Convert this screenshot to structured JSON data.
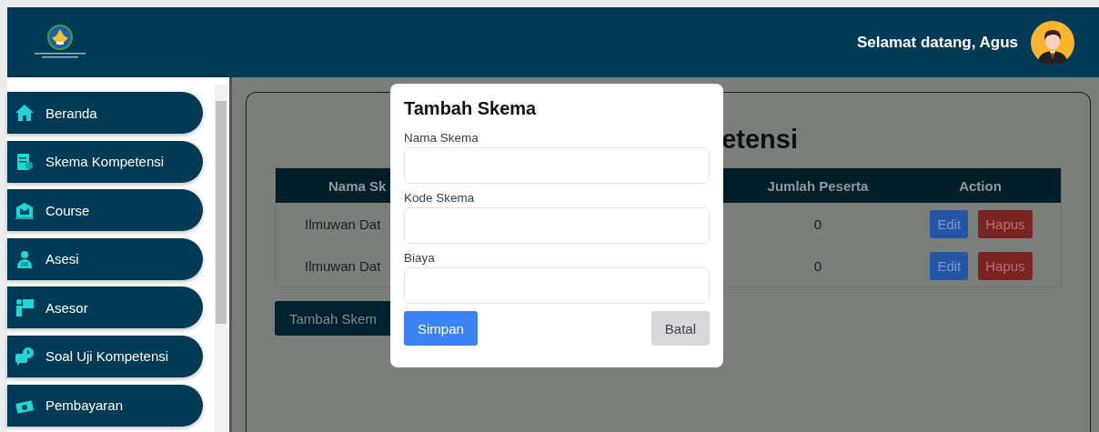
{
  "header": {
    "welcome": "Selamat datang, Agus"
  },
  "sidebar": {
    "items": [
      {
        "label": "Beranda"
      },
      {
        "label": "Skema Kompetensi"
      },
      {
        "label": "Course"
      },
      {
        "label": "Asesi"
      },
      {
        "label": "Asesor"
      },
      {
        "label": "Soal Uji Kompetensi"
      },
      {
        "label": "Pembayaran"
      }
    ]
  },
  "page": {
    "heading": "etensi",
    "table": {
      "columns": [
        "Nama Sk",
        "Jumlah Peserta",
        "Action"
      ],
      "rows": [
        {
          "cells": [
            "Ilmuwan Dat",
            "0"
          ],
          "actions": [
            {
              "label": "Edit",
              "kind": "primary"
            },
            {
              "label": "Hapus",
              "kind": "danger"
            }
          ]
        },
        {
          "cells": [
            "Ilmuwan Dat",
            "0"
          ],
          "actions": [
            {
              "label": "Edit",
              "kind": "primary"
            },
            {
              "label": "Hapus",
              "kind": "danger"
            }
          ]
        }
      ]
    },
    "add_button": "Tambah Skem"
  },
  "modal": {
    "title": "Tambah Skema",
    "fields": [
      {
        "label": "Nama Skema"
      },
      {
        "label": "Kode Skema"
      },
      {
        "label": "Biaya"
      }
    ],
    "buttons": [
      {
        "label": "Simpan",
        "kind": "primary"
      },
      {
        "label": "Batal",
        "kind": "secondary"
      }
    ]
  }
}
